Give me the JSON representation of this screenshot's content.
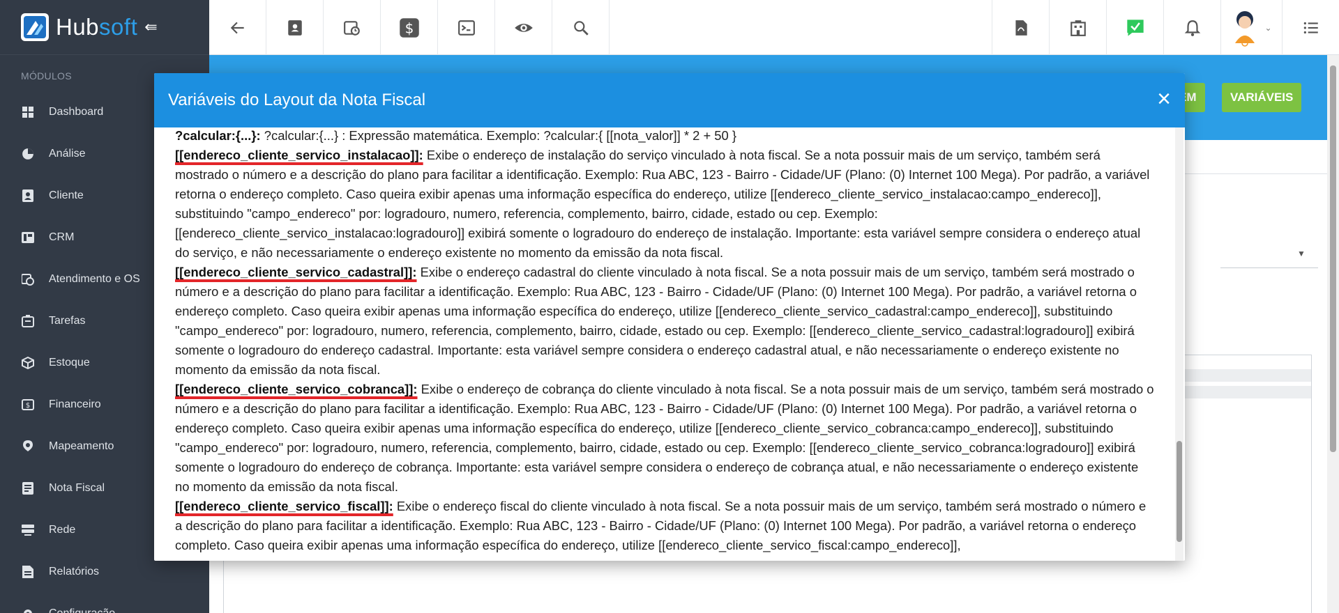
{
  "app": {
    "logo_main": "Hub",
    "logo_accent": "soft",
    "collapse_icon": "collapse-left-icon"
  },
  "sidebar": {
    "section_title": "MÓDULOS",
    "items": [
      {
        "label": "Dashboard",
        "icon": "dashboard-icon"
      },
      {
        "label": "Análise",
        "icon": "pie-chart-icon"
      },
      {
        "label": "Cliente",
        "icon": "contact-card-icon"
      },
      {
        "label": "CRM",
        "icon": "crm-board-icon"
      },
      {
        "label": "Atendimento e OS",
        "icon": "calendar-clock-icon"
      },
      {
        "label": "Tarefas",
        "icon": "task-board-icon"
      },
      {
        "label": "Estoque",
        "icon": "box-icon"
      },
      {
        "label": "Financeiro",
        "icon": "money-icon"
      },
      {
        "label": "Mapeamento",
        "icon": "map-pin-icon"
      },
      {
        "label": "Nota Fiscal",
        "icon": "invoice-icon"
      },
      {
        "label": "Rede",
        "icon": "network-icon"
      },
      {
        "label": "Relatórios",
        "icon": "report-icon"
      },
      {
        "label": "Configuração",
        "icon": "gear-icon"
      }
    ]
  },
  "topbar": {
    "left_icons": [
      "back-arrow-icon",
      "contact-card-icon",
      "calendar-clock-icon",
      "dollar-icon",
      "terminal-icon",
      "eye-icon",
      "search-icon"
    ],
    "right_icons": [
      "pdf-file-icon",
      "building-icon",
      "check-message-icon",
      "bell-icon",
      "user-avatar",
      "list-menu-icon"
    ],
    "accent_green": "#2ec95c"
  },
  "header_buttons": {
    "partial_label": "EM",
    "variables_label": "VARIÁVEIS"
  },
  "modal": {
    "title": "Variáveis do Layout da Nota Fiscal",
    "close_label": "×",
    "entries": [
      {
        "name": "?calcular:{...}:",
        "underlined": false,
        "text": " ?calcular:{...} : Expressão matemática. Exemplo: ?calcular:{ [[nota_valor]] * 2 + 50 }"
      },
      {
        "name": "[[endereco_cliente_servico_instalacao]]:",
        "underlined": true,
        "text": " Exibe o endereço de instalação do serviço vinculado à nota fiscal. Se a nota possuir mais de um serviço, também será mostrado o número e a descrição do plano para facilitar a identificação. Exemplo: Rua ABC, 123 - Bairro - Cidade/UF (Plano: (0) Internet 100 Mega). Por padrão, a variável retorna o endereço completo. Caso queira exibir apenas uma informação específica do endereço, utilize [[endereco_cliente_servico_instalacao:campo_endereco]], substituindo \"campo_endereco\" por: logradouro, numero, referencia, complemento, bairro, cidade, estado ou cep. Exemplo: [[endereco_cliente_servico_instalacao:logradouro]] exibirá somente o logradouro do endereço de instalação. Importante: esta variável sempre considera o endereço atual do serviço, e não necessariamente o endereço existente no momento da emissão da nota fiscal."
      },
      {
        "name": "[[endereco_cliente_servico_cadastral]]:",
        "underlined": true,
        "text": " Exibe o endereço cadastral do cliente vinculado à nota fiscal. Se a nota possuir mais de um serviço, também será mostrado o número e a descrição do plano para facilitar a identificação. Exemplo: Rua ABC, 123 - Bairro - Cidade/UF (Plano: (0) Internet 100 Mega). Por padrão, a variável retorna o endereço completo. Caso queira exibir apenas uma informação específica do endereço, utilize [[endereco_cliente_servico_cadastral:campo_endereco]], substituindo \"campo_endereco\" por: logradouro, numero, referencia, complemento, bairro, cidade, estado ou cep. Exemplo: [[endereco_cliente_servico_cadastral:logradouro]] exibirá somente o logradouro do endereço cadastral. Importante: esta variável sempre considera o endereço cadastral atual, e não necessariamente o endereço existente no momento da emissão da nota fiscal."
      },
      {
        "name": "[[endereco_cliente_servico_cobranca]]:",
        "underlined": true,
        "text": " Exibe o endereço de cobrança do cliente vinculado à nota fiscal. Se a nota possuir mais de um serviço, também será mostrado o número e a descrição do plano para facilitar a identificação. Exemplo: Rua ABC, 123 - Bairro - Cidade/UF (Plano: (0) Internet 100 Mega). Por padrão, a variável retorna o endereço completo. Caso queira exibir apenas uma informação específica do endereço, utilize [[endereco_cliente_servico_cobranca:campo_endereco]], substituindo \"campo_endereco\" por: logradouro, numero, referencia, complemento, bairro, cidade, estado ou cep. Exemplo: [[endereco_cliente_servico_cobranca:logradouro]] exibirá somente o logradouro do endereço de cobrança. Importante: esta variável sempre considera o endereço de cobrança atual, e não necessariamente o endereço existente no momento da emissão da nota fiscal."
      },
      {
        "name": "[[endereco_cliente_servico_fiscal]]:",
        "underlined": true,
        "text": " Exibe o endereço fiscal do cliente vinculado à nota fiscal. Se a nota possuir mais de um serviço, também será mostrado o número e a descrição do plano para facilitar a identificação. Exemplo: Rua ABC, 123 - Bairro - Cidade/UF (Plano: (0) Internet 100 Mega). Por padrão, a variável retorna o endereço completo. Caso queira exibir apenas uma informação específica do endereço, utilize [[endereco_cliente_servico_fiscal:campo_endereco]],"
      }
    ]
  },
  "colors": {
    "sidebar_bg": "#323a46",
    "brand_blue": "#2c9ee6",
    "modal_header": "#1c8fe0",
    "button_green": "#7dc242",
    "highlight_red": "#e3262a"
  }
}
